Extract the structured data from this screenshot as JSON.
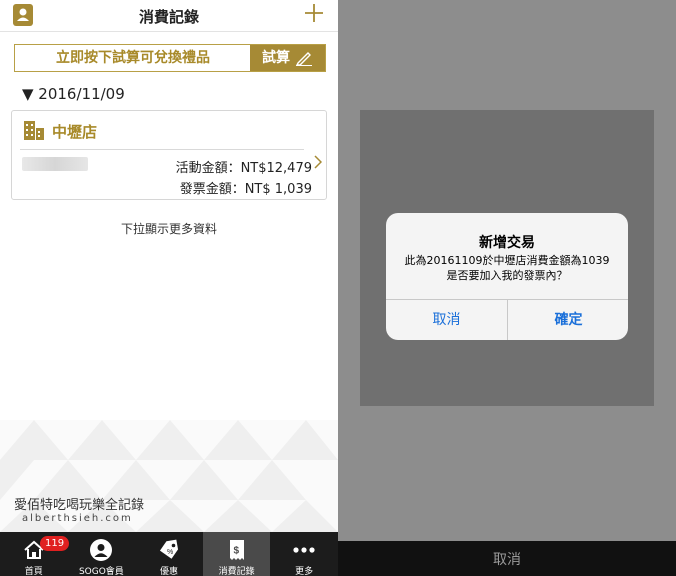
{
  "header": {
    "title": "消費記錄",
    "left_icon": "member-card-icon",
    "right_icon": "plus-icon"
  },
  "calc_banner": {
    "text": "立即按下試算可兌換禮品",
    "button_label": "試算",
    "button_icon": "pencil-icon"
  },
  "date_group": {
    "label": "▼ 2016/11/09"
  },
  "record": {
    "store_icon": "building-icon",
    "store_name": "中壢店",
    "activity_amount": "活動金額：NT$12,479",
    "invoice_amount": "發票金額：NT$  1,039"
  },
  "load_more_hint": "下拉顯示更多資料",
  "watermark": {
    "line1": "愛佰特吃喝玩樂全記錄",
    "line2": "alberthsieh.com"
  },
  "tabs": [
    {
      "label": "首頁",
      "icon": "home-icon",
      "badge": "119"
    },
    {
      "label": "SOGO會員",
      "icon": "user-icon"
    },
    {
      "label": "優惠",
      "icon": "tag-icon"
    },
    {
      "label": "消費記錄",
      "icon": "receipt-icon",
      "active": true
    },
    {
      "label": "更多",
      "icon": "more-icon"
    }
  ],
  "alert": {
    "title": "新增交易",
    "message_line1": "此為20161109於中壢店消費金額為1039",
    "message_line2": "是否要加入我的發票內？",
    "cancel_label": "取消",
    "confirm_label": "確定"
  },
  "scanner_bottom": {
    "cancel_label": "取消"
  },
  "colors": {
    "gold": "#a68a35",
    "tabbar": "#1c1c1c",
    "alert_button": "#1a6fd9",
    "overlay": "#8d8d8d"
  }
}
